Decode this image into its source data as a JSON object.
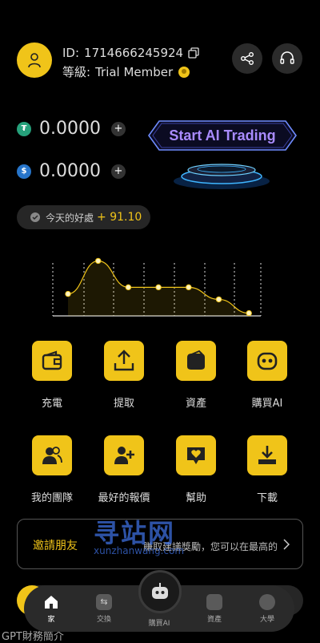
{
  "profile": {
    "id_label": "ID:",
    "id_value": "1714666245924",
    "level_label": "等級:",
    "level_value": "Trial Member"
  },
  "balances": [
    {
      "coin": "usdt",
      "amount": "0.0000",
      "color": "#26a17b"
    },
    {
      "coin": "usdc",
      "amount": "0.0000",
      "color": "#2775ca"
    }
  ],
  "ai_trading_button": "Start AI Trading",
  "bonus": {
    "label": "今天的好處",
    "value": "+ 91.10"
  },
  "chart_data": {
    "type": "line",
    "x": [
      1,
      2,
      3,
      4,
      5,
      6,
      7
    ],
    "values": [
      0.4,
      1.0,
      0.52,
      0.52,
      0.52,
      0.3,
      0.05
    ],
    "ylim": [
      0,
      1.05
    ],
    "grid": "vertical dashed",
    "color": "#f0c419"
  },
  "actions": [
    {
      "label": "充電",
      "icon": "wallet-icon"
    },
    {
      "label": "提取",
      "icon": "upload-icon"
    },
    {
      "label": "資產",
      "icon": "wallet-assets-icon"
    },
    {
      "label": "購買AI",
      "icon": "robot-icon"
    },
    {
      "label": "我的團隊",
      "icon": "team-icon"
    },
    {
      "label": "最好的報價",
      "icon": "add-user-icon"
    },
    {
      "label": "幫助",
      "icon": "help-heart-icon"
    },
    {
      "label": "下載",
      "icon": "download-icon"
    }
  ],
  "invite": {
    "title": "邀請朋友",
    "subtitle": "賺取建議獎勵，您可以在最高的",
    "watermark_big": "寻站网",
    "watermark_small": "xunzhanwang.com"
  },
  "section_peek": "GPT財務簡介",
  "tabs": [
    {
      "label": "家",
      "active": true
    },
    {
      "label": "交換",
      "active": false
    },
    {
      "label": "購買AI",
      "active": false
    },
    {
      "label": "資產",
      "active": false
    },
    {
      "label": "大學",
      "active": false
    }
  ],
  "colors": {
    "accent": "#f0c419",
    "background": "#000000",
    "card": "#262626"
  }
}
